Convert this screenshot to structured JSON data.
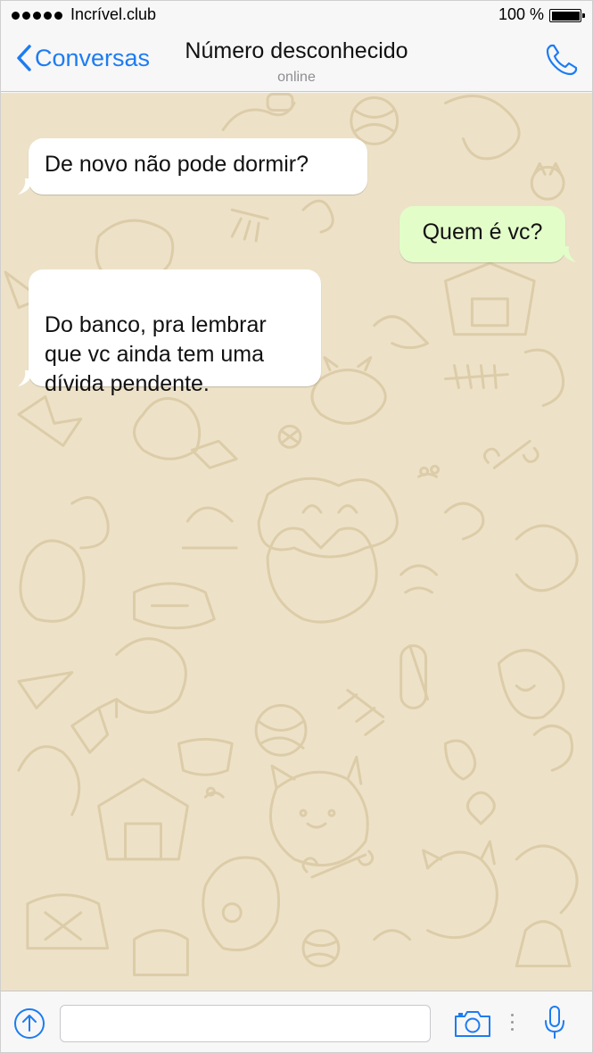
{
  "status_bar": {
    "carrier": "Incrível.club",
    "battery_percent": "100 %",
    "battery_level": 1.0
  },
  "nav": {
    "back_label": "Conversas",
    "title": "Número desconhecido",
    "subtitle": "online"
  },
  "messages": [
    {
      "direction": "incoming",
      "text": "De novo não pode dormir?"
    },
    {
      "direction": "outgoing",
      "text": "Quem é vc?"
    },
    {
      "direction": "incoming",
      "text": "Do banco, pra lembrar\nque vc ainda tem uma\ndívida pendente."
    }
  ],
  "input_bar": {
    "message_value": "",
    "icons": [
      "upload-icon",
      "camera-icon",
      "microphone-icon"
    ]
  },
  "colors": {
    "accent": "#1d7cf2",
    "chat_background": "#ede2c8",
    "incoming_bubble": "#ffffff",
    "outgoing_bubble": "#e3fdc9"
  }
}
